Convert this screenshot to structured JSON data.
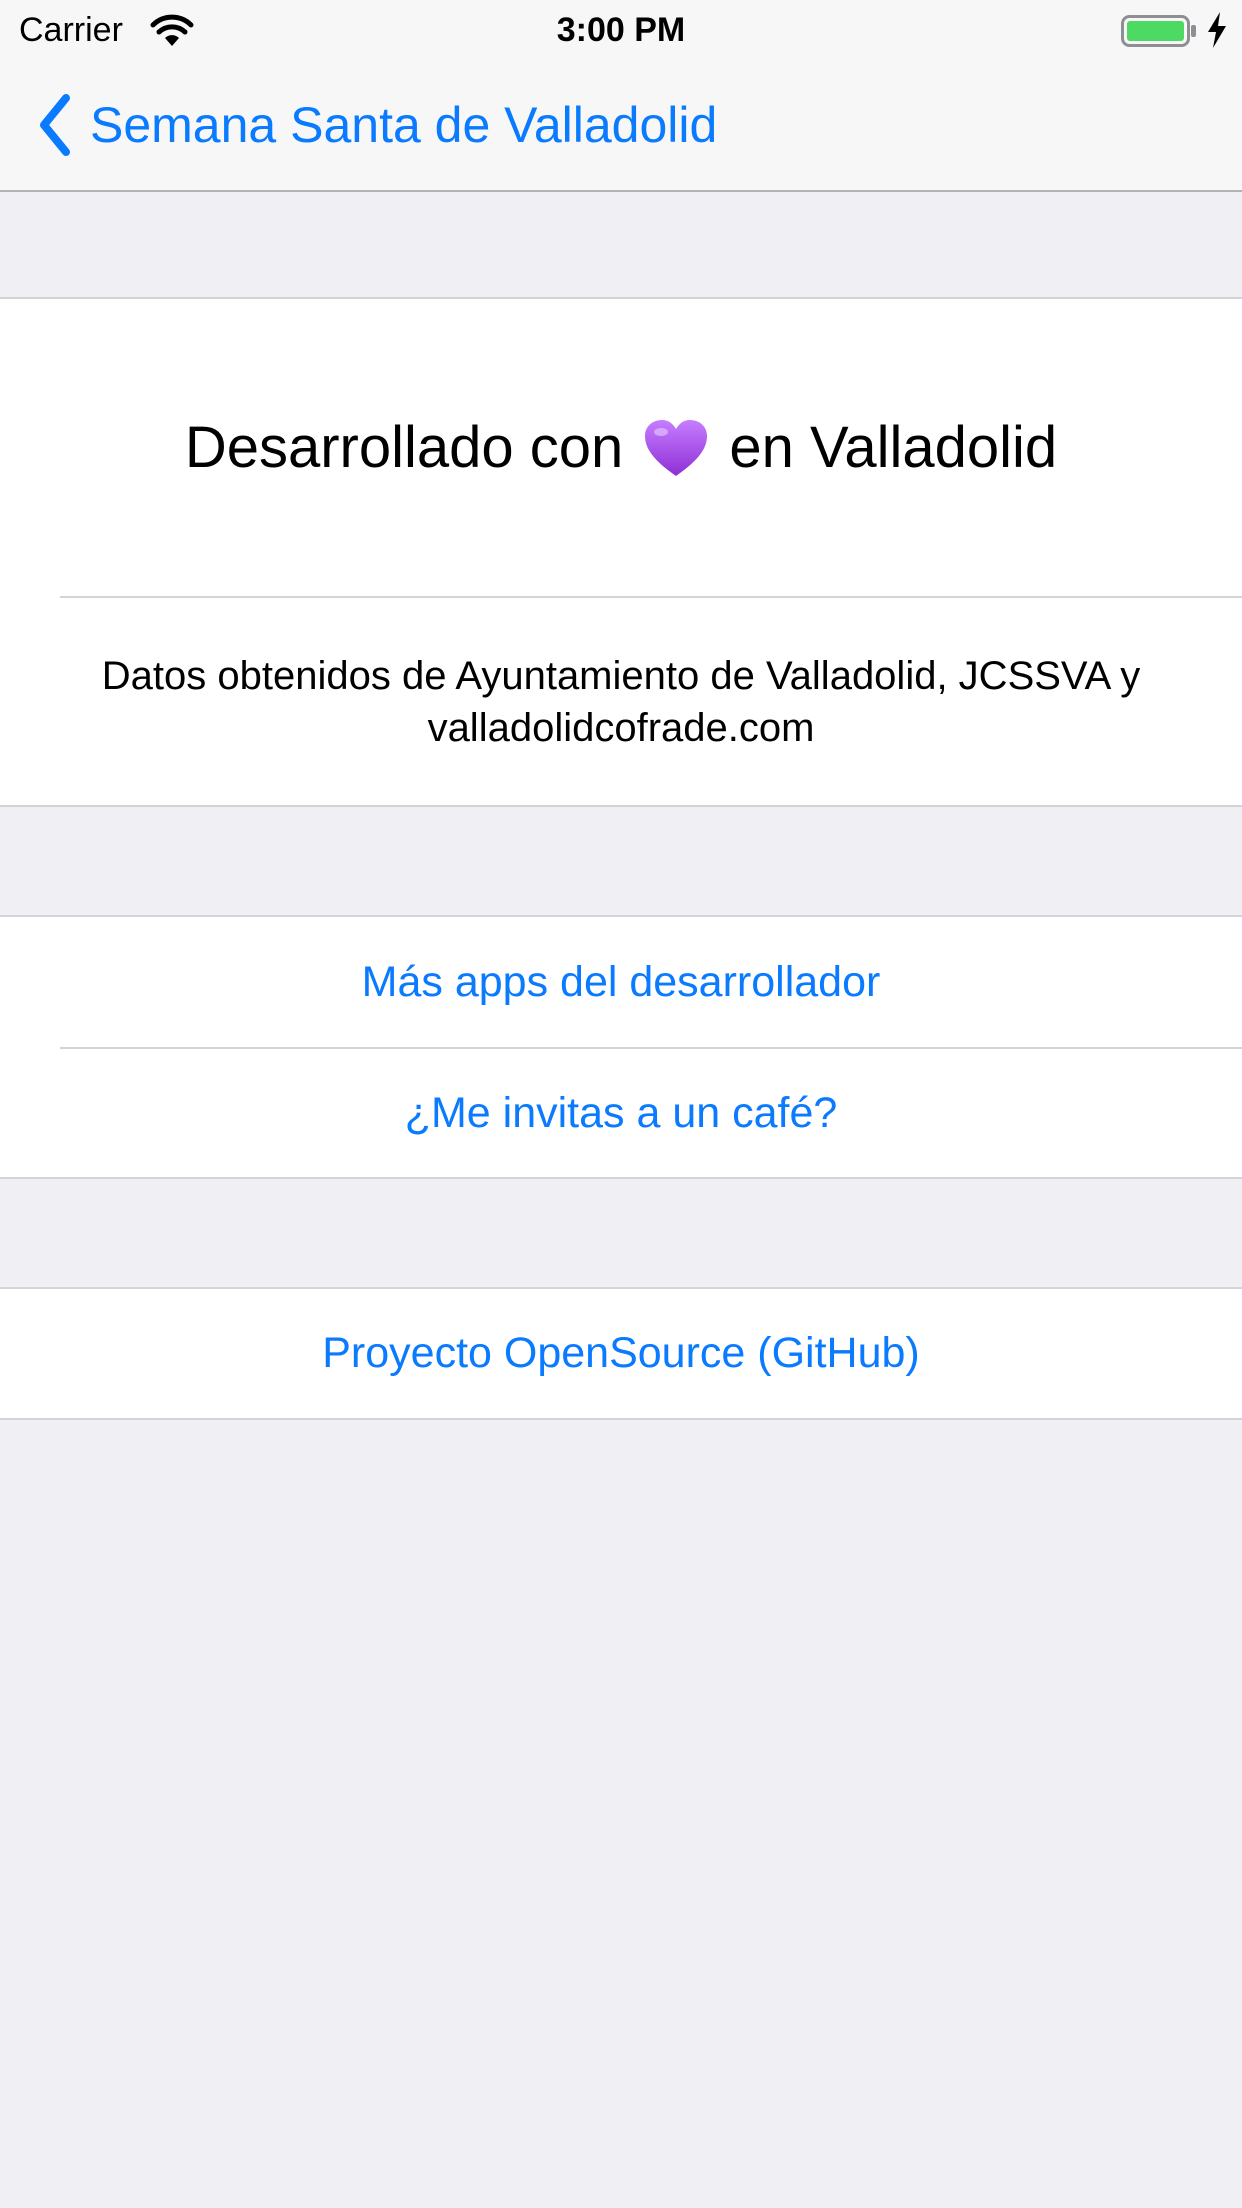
{
  "status_bar": {
    "carrier": "Carrier",
    "time": "3:00 PM",
    "icons": [
      "wifi-icon",
      "battery-icon",
      "charging-icon"
    ],
    "battery_color": "#4cd964"
  },
  "nav": {
    "back_label": "Semana Santa de Valladolid",
    "back_icon": "chevron-left-icon",
    "tint_color": "#0a7aff"
  },
  "info_section": {
    "title_before": "Desarrollado con",
    "title_icon": "purple-heart-icon",
    "title_after": "en Valladolid",
    "credits": "Datos obtenidos de Ayuntamiento de Valladolid, JCSSVA y valladolidcofrade.com"
  },
  "links_section": {
    "items": [
      {
        "label": "Más apps del desarrollador"
      },
      {
        "label": "¿Me invitas a un café?"
      }
    ]
  },
  "opensource_section": {
    "label": "Proyecto OpenSource (GitHub)"
  },
  "colors": {
    "background": "#efeff4",
    "cell_background": "#ffffff",
    "link": "#0a7aff",
    "heart": "#a64ed8"
  }
}
